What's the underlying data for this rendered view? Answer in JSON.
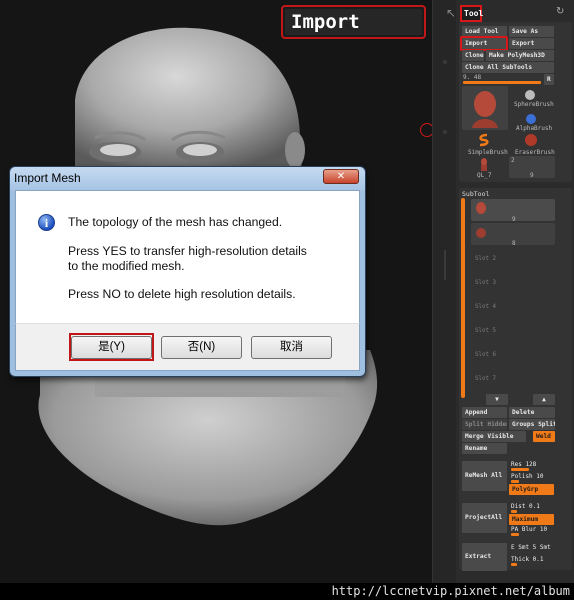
{
  "callout": {
    "label": "Import"
  },
  "dialog": {
    "title": "Import Mesh",
    "close_label": "✕",
    "message_line1": "The topology of the mesh has changed.",
    "message_line2": "Press YES to transfer high-resolution details",
    "message_line3": "to the modified mesh.",
    "message_line4": "Press NO to delete high resolution details.",
    "info_icon": "i",
    "buttons": {
      "yes": "是(Y)",
      "no": "否(N)",
      "cancel": "取消"
    }
  },
  "panel": {
    "tool_tab": "Tool",
    "refresh_icon": "↻",
    "back_icon": "↖",
    "buttons": {
      "load_tool": "Load Tool",
      "save_as": "Save As",
      "import": "Import",
      "export": "Export",
      "clone": "Clone",
      "make_polymesh": "Make PolyMesh3D",
      "clone_all": "Clone All SubTools"
    },
    "size_value": "9. 48",
    "r_label": "R",
    "brushes": {
      "sphere": "SphereBrush",
      "alpha": "AlphaBrush",
      "simple": "SimpleBrush",
      "eraser": "EraserBrush",
      "ql": "QL_7",
      "count_2": "2",
      "count_9": "9"
    },
    "subtool": {
      "title": "SubTool",
      "item1_count": "9",
      "item2_count": "8",
      "slots": [
        "Slot 2",
        "Slot 3",
        "Slot 4",
        "Slot 5",
        "Slot 6",
        "Slot 7"
      ],
      "append": "Append",
      "delete": "Delete",
      "split_hidden": "Split Hidden",
      "groups_split": "Groups Split",
      "merge_visible": "Merge Visible",
      "weld": "Weld",
      "rename": "Rename",
      "remesh_all": "ReMesh All",
      "res": "Res 128",
      "polish": "Polish 10",
      "polygrp": "PolyGrp",
      "project_all": "ProjectAll",
      "dist": "Dist 0.1",
      "maximum": "Maximum",
      "pa_blur": "PA Blur 10",
      "extract": "Extract",
      "e_smt": "E Smt 5 Smt",
      "thick": "Thick 0.1"
    }
  },
  "url": "http://lccnetvip.pixnet.net/album",
  "colors": {
    "accent": "#f07a18",
    "highlight_red": "#d81818",
    "panel_bg": "#2b2b2b",
    "dialog_frame": "#9fbfe0"
  }
}
